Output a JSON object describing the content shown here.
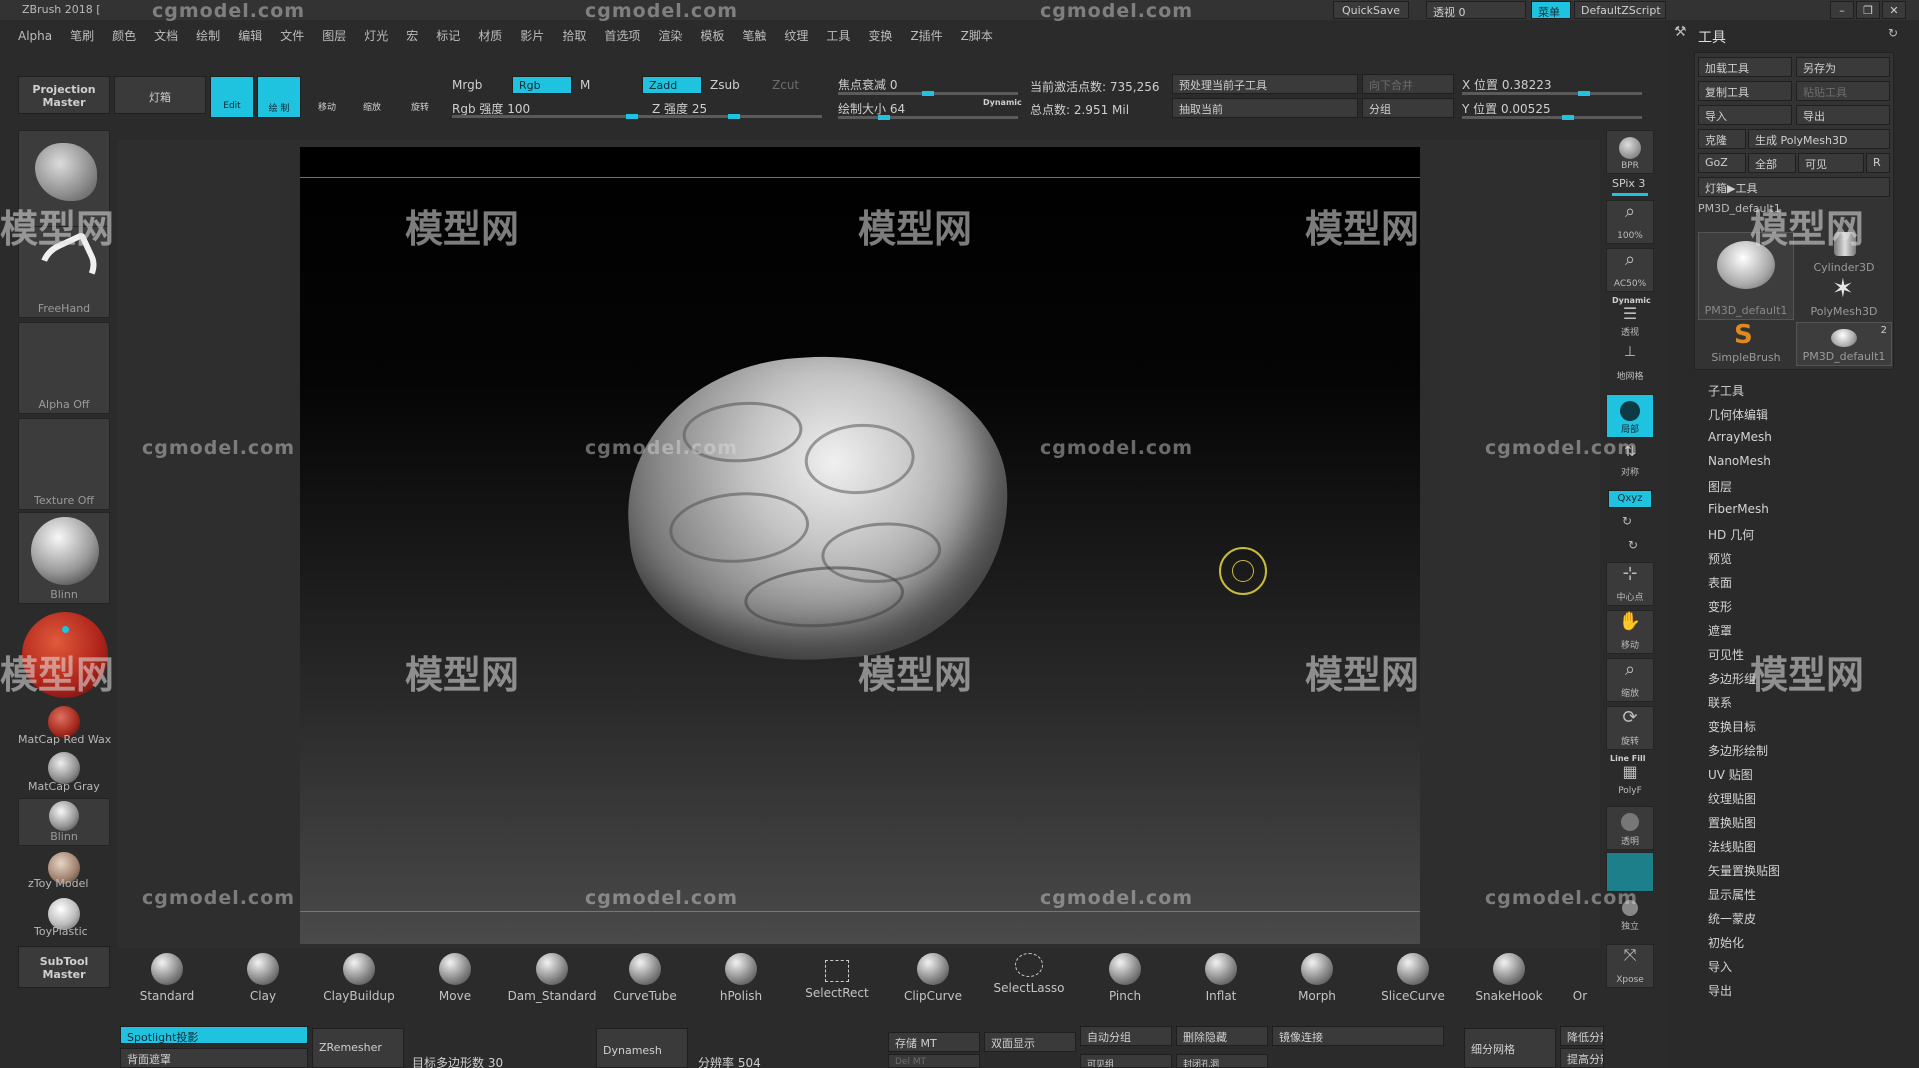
{
  "app": {
    "title": "ZBrush 2018 ["
  },
  "titlebar": {
    "quicksave": "QuickSave",
    "transparency_label": "透视 0",
    "menus_btn": "菜单",
    "zscript": "DefaultZScript"
  },
  "menubar": [
    "Alpha",
    "笔刷",
    "颜色",
    "文档",
    "绘制",
    "编辑",
    "文件",
    "图层",
    "灯光",
    "宏",
    "标记",
    "材质",
    "影片",
    "拾取",
    "首选项",
    "渲染",
    "模板",
    "笔触",
    "纹理",
    "工具",
    "变换",
    "Z插件",
    "Z脚本"
  ],
  "toolbar": {
    "projection_master": "Projection Master",
    "lightbox": "灯箱",
    "edit": "Edit",
    "draw": "绘 制",
    "move": "移动",
    "scale": "缩放",
    "rotate": "旋转",
    "mrgb": "Mrgb",
    "rgb": "Rgb",
    "m": "M",
    "rgb_intensity": "Rgb 强度 100",
    "zadd": "Zadd",
    "zsub": "Zsub",
    "zcut": "Zcut",
    "z_intensity": "Z 强度 25",
    "focal_shift": "焦点衰减 0",
    "draw_size": "绘制大小 64",
    "dynamic": "Dynamic",
    "active_points": "当前激活点数: 735,256",
    "total_points": "总点数: 2.951 Mil",
    "pre_process": "预处理当前子工具",
    "merge_down": "向下合并",
    "extract": "抽取当前",
    "split": "分组",
    "x_pos": "X 位置 0.38223",
    "y_pos": "Y 位置 0.00525"
  },
  "left_shelf": {
    "freehand": "FreeHand",
    "alpha_off": "Alpha Off",
    "texture_off": "Texture Off",
    "blinn": "Blinn",
    "matcap_red_wax": "MatCap Red Wax",
    "matcap_gray": "MatCap Gray",
    "blinn2": "Blinn",
    "toy_model": "zToy Model",
    "toy_plastic": "ToyPlastic",
    "subtool_master": "SubTool Master"
  },
  "right_column": [
    {
      "name": "bpr",
      "label": "BPR"
    },
    {
      "name": "spix",
      "label": "SPix 3"
    },
    {
      "name": "zoom100",
      "label": "100%"
    },
    {
      "name": "ac50",
      "label": "AC50%"
    },
    {
      "name": "persp",
      "label": "透视"
    },
    {
      "name": "floor",
      "label": "地网格"
    },
    {
      "name": "local",
      "label": "局部"
    },
    {
      "name": "sym",
      "label": "对称"
    },
    {
      "name": "xyz",
      "label": "Qxyz"
    },
    {
      "name": "center",
      "label": "中心点"
    },
    {
      "name": "move",
      "label": "移动"
    },
    {
      "name": "scale",
      "label": "缩放"
    },
    {
      "name": "rotate",
      "label": "旋转"
    },
    {
      "name": "polyf",
      "label": "PolyF"
    },
    {
      "name": "transp",
      "label": "透明"
    },
    {
      "name": "solo",
      "label": "独立"
    },
    {
      "name": "xpose",
      "label": "Xpose"
    }
  ],
  "right_column_extra": {
    "line_fill": "Line Fill",
    "dynamic": "Dynamic"
  },
  "tool_panel": {
    "title": "工具",
    "load_tool": "加载工具",
    "save_as": "另存为",
    "copy_tool": "复制工具",
    "paste_tool": "粘贴工具",
    "import": "导入",
    "export": "导出",
    "clone": "克隆",
    "make_polymesh": "生成 PolyMesh3D",
    "goz": "GoZ",
    "all": "全部",
    "visible": "可见",
    "r": "R",
    "lightbox_tools": "灯箱▶工具",
    "pm3d": "PM3D_default1",
    "thumbs": [
      {
        "label": "PM3D_default1"
      },
      {
        "label": "Cylinder3D"
      },
      {
        "label": "PolyMesh3D"
      },
      {
        "label": "SimpleBrush"
      },
      {
        "label": "PM3D_default1"
      }
    ],
    "thumb_count": "2",
    "items": [
      "子工具",
      "几何体编辑",
      "ArrayMesh",
      "NanoMesh",
      "图层",
      "FiberMesh",
      "HD 几何",
      "预览",
      "表面",
      "变形",
      "遮罩",
      "可见性",
      "多边形组",
      "联系",
      "变换目标",
      "多边形绘制",
      "UV 贴图",
      "纹理贴图",
      "置换贴图",
      "法线贴图",
      "矢量置换贴图",
      "显示属性",
      "统一蒙皮",
      "初始化",
      "导入",
      "导出"
    ]
  },
  "brushes": [
    "Standard",
    "Clay",
    "ClayBuildup",
    "Move",
    "Dam_Standard",
    "CurveTube",
    "hPolish",
    "SelectRect",
    "ClipCurve",
    "SelectLasso",
    "Pinch",
    "Inflat",
    "Morph",
    "SliceCurve",
    "SnakeHook",
    "Or"
  ],
  "bottom_bar": {
    "spotlight": "Spotlight投影",
    "back_mask": "背面遮罩",
    "zremesher": "ZRemesher",
    "target_poly": "目标多边形数 30",
    "dynamesh": "Dynamesh",
    "resolution": "分辨率 504",
    "store_mt": "存储 MT",
    "del_mt": "Del MT",
    "double": "双面显示",
    "auto_groups": "自动分组",
    "visible": "可见组",
    "del_hidden": "删除隐藏",
    "close_holes": "封闭孔洞",
    "mirror_weld": "镜像连接",
    "divide": "细分网格",
    "lower_res": "降低分辨",
    "higher_res": "提高分辨"
  },
  "watermarks": {
    "site": "cgmodel.com",
    "brand": "模型网"
  },
  "colors": {
    "accent": "#1fc3e0",
    "bg": "#2b2b2b",
    "panel": "#3a3a3a"
  }
}
